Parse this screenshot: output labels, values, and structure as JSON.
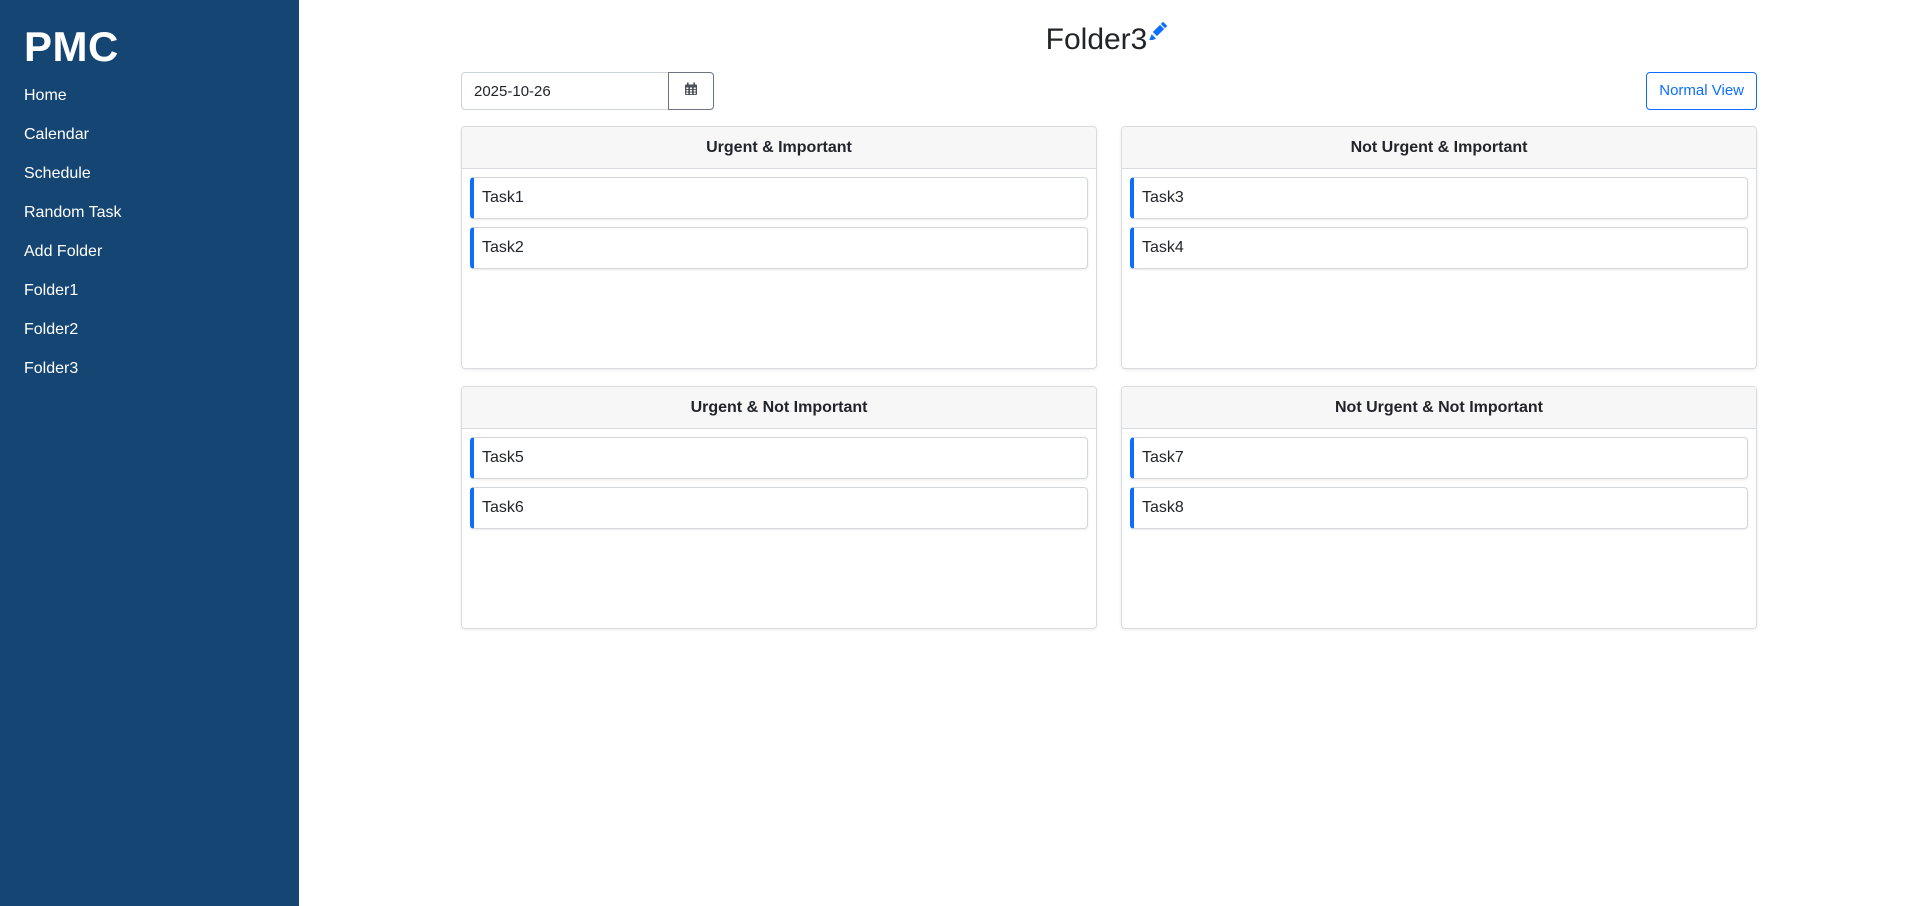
{
  "sidebar": {
    "brand": "PMC",
    "items": [
      {
        "label": "Home"
      },
      {
        "label": "Calendar"
      },
      {
        "label": "Schedule"
      },
      {
        "label": "Random Task"
      },
      {
        "label": "Add Folder"
      },
      {
        "label": "Folder1"
      },
      {
        "label": "Folder2"
      },
      {
        "label": "Folder3"
      }
    ]
  },
  "header": {
    "title": "Folder3",
    "edit_icon": "pencil-icon"
  },
  "toolbar": {
    "date_value": "2025-10-26",
    "calendar_icon": "calendar-icon",
    "view_button": "Normal View"
  },
  "quadrants": [
    {
      "title": "Urgent & Important",
      "tasks": [
        "Task1",
        "Task2"
      ]
    },
    {
      "title": "Not Urgent & Important",
      "tasks": [
        "Task3",
        "Task4"
      ]
    },
    {
      "title": "Urgent & Not Important",
      "tasks": [
        "Task5",
        "Task6"
      ]
    },
    {
      "title": "Not Urgent & Not Important",
      "tasks": [
        "Task7",
        "Task8"
      ]
    }
  ],
  "colors": {
    "sidebar_bg": "#154673",
    "accent": "#0d6efd"
  }
}
